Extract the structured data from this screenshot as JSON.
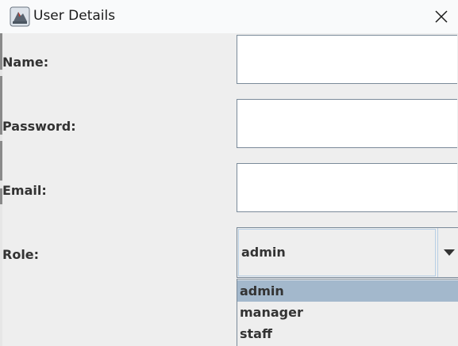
{
  "window": {
    "title": "User Details",
    "icon": "java-app-icon",
    "close_icon": "close-icon"
  },
  "form": {
    "name_label": "Name:",
    "name_value": "",
    "password_label": "Password:",
    "password_value": "",
    "email_label": "Email:",
    "email_value": "",
    "role_label": "Role:",
    "role_selected": "admin",
    "role_options": [
      "admin",
      "manager",
      "staff"
    ]
  },
  "colors": {
    "selection": "#a3b8cc",
    "field_border": "#7a8a99",
    "combo_focus": "#b8cfe5"
  }
}
